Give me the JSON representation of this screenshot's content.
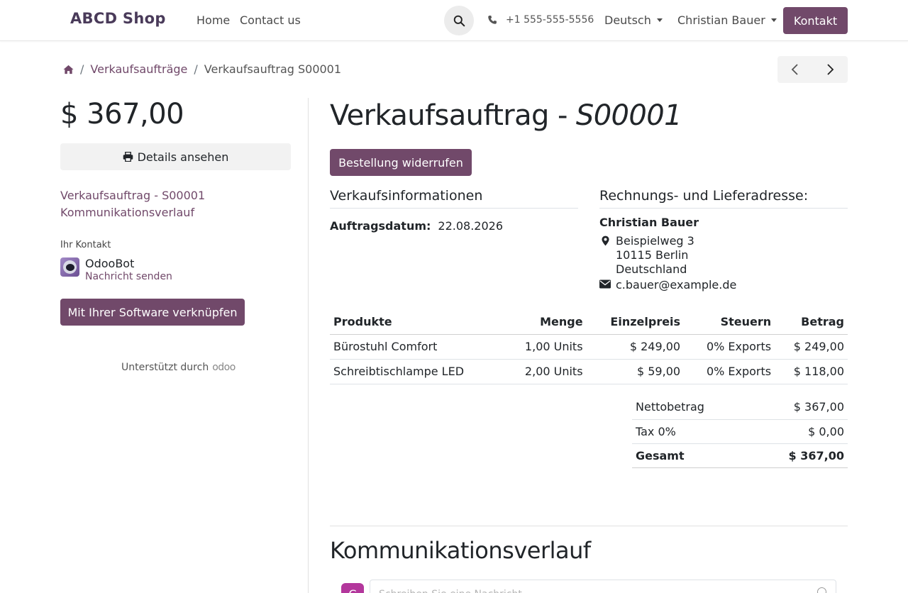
{
  "navbar": {
    "brand": "ABCD Shop",
    "links": [
      "Home",
      "Contact us"
    ],
    "phone": "+1 555-555-5556",
    "language": "Deutsch",
    "user": "Christian Bauer",
    "contact_button": "Kontakt"
  },
  "breadcrumb": {
    "items": [
      "Verkaufsaufträge",
      "Verkaufsauftrag S00001"
    ]
  },
  "sidebar": {
    "amount": "$ 367,00",
    "details_button": "Details ansehen",
    "links": [
      "Verkaufsauftrag - S00001",
      "Kommunikationsverlauf"
    ],
    "contact_label": "Ihr Kontakt",
    "contact_name": "OdooBot",
    "contact_action": "Nachricht senden",
    "connect_button": "Mit Ihrer Software verknüpfen",
    "powered_by": "Unterstützt durch",
    "powered_logo": "odoo"
  },
  "main": {
    "title_prefix": "Verkaufsauftrag - ",
    "title_ref": "S00001",
    "cancel_button": "Bestellung widerrufen",
    "info_title": "Verkaufsinformationen",
    "address_title": "Rechnungs- und Lieferadresse:",
    "order_date_label": "Auftragsdatum:",
    "order_date": "22.08.2026",
    "address": {
      "name": "Christian Bauer",
      "street": "Beispielweg 3",
      "city": "10115 Berlin",
      "country": "Deutschland",
      "email": "c.bauer@example.de"
    },
    "table": {
      "headers": [
        "Produkte",
        "Menge",
        "Einzelpreis",
        "Steuern",
        "Betrag"
      ],
      "rows": [
        [
          "Bürostuhl Comfort",
          "1,00 Units",
          "$ 249,00",
          "0% Exports",
          "$ 249,00"
        ],
        [
          "Schreibtischlampe LED",
          "2,00 Units",
          "$ 59,00",
          "0% Exports",
          "$ 118,00"
        ]
      ]
    },
    "totals": [
      {
        "label": "Nettobetrag",
        "value": "$ 367,00"
      },
      {
        "label": "Tax 0%",
        "value": "$ 0,00"
      },
      {
        "label": "Gesamt",
        "value": "$ 367,00"
      }
    ],
    "chatter_title": "Kommunikationsverlauf",
    "chatter_avatar": "C",
    "chatter_placeholder": "Schreiben Sie eine Nachricht..."
  },
  "colors": {
    "accent": "#71496a",
    "brand": "#4a3b5a"
  }
}
